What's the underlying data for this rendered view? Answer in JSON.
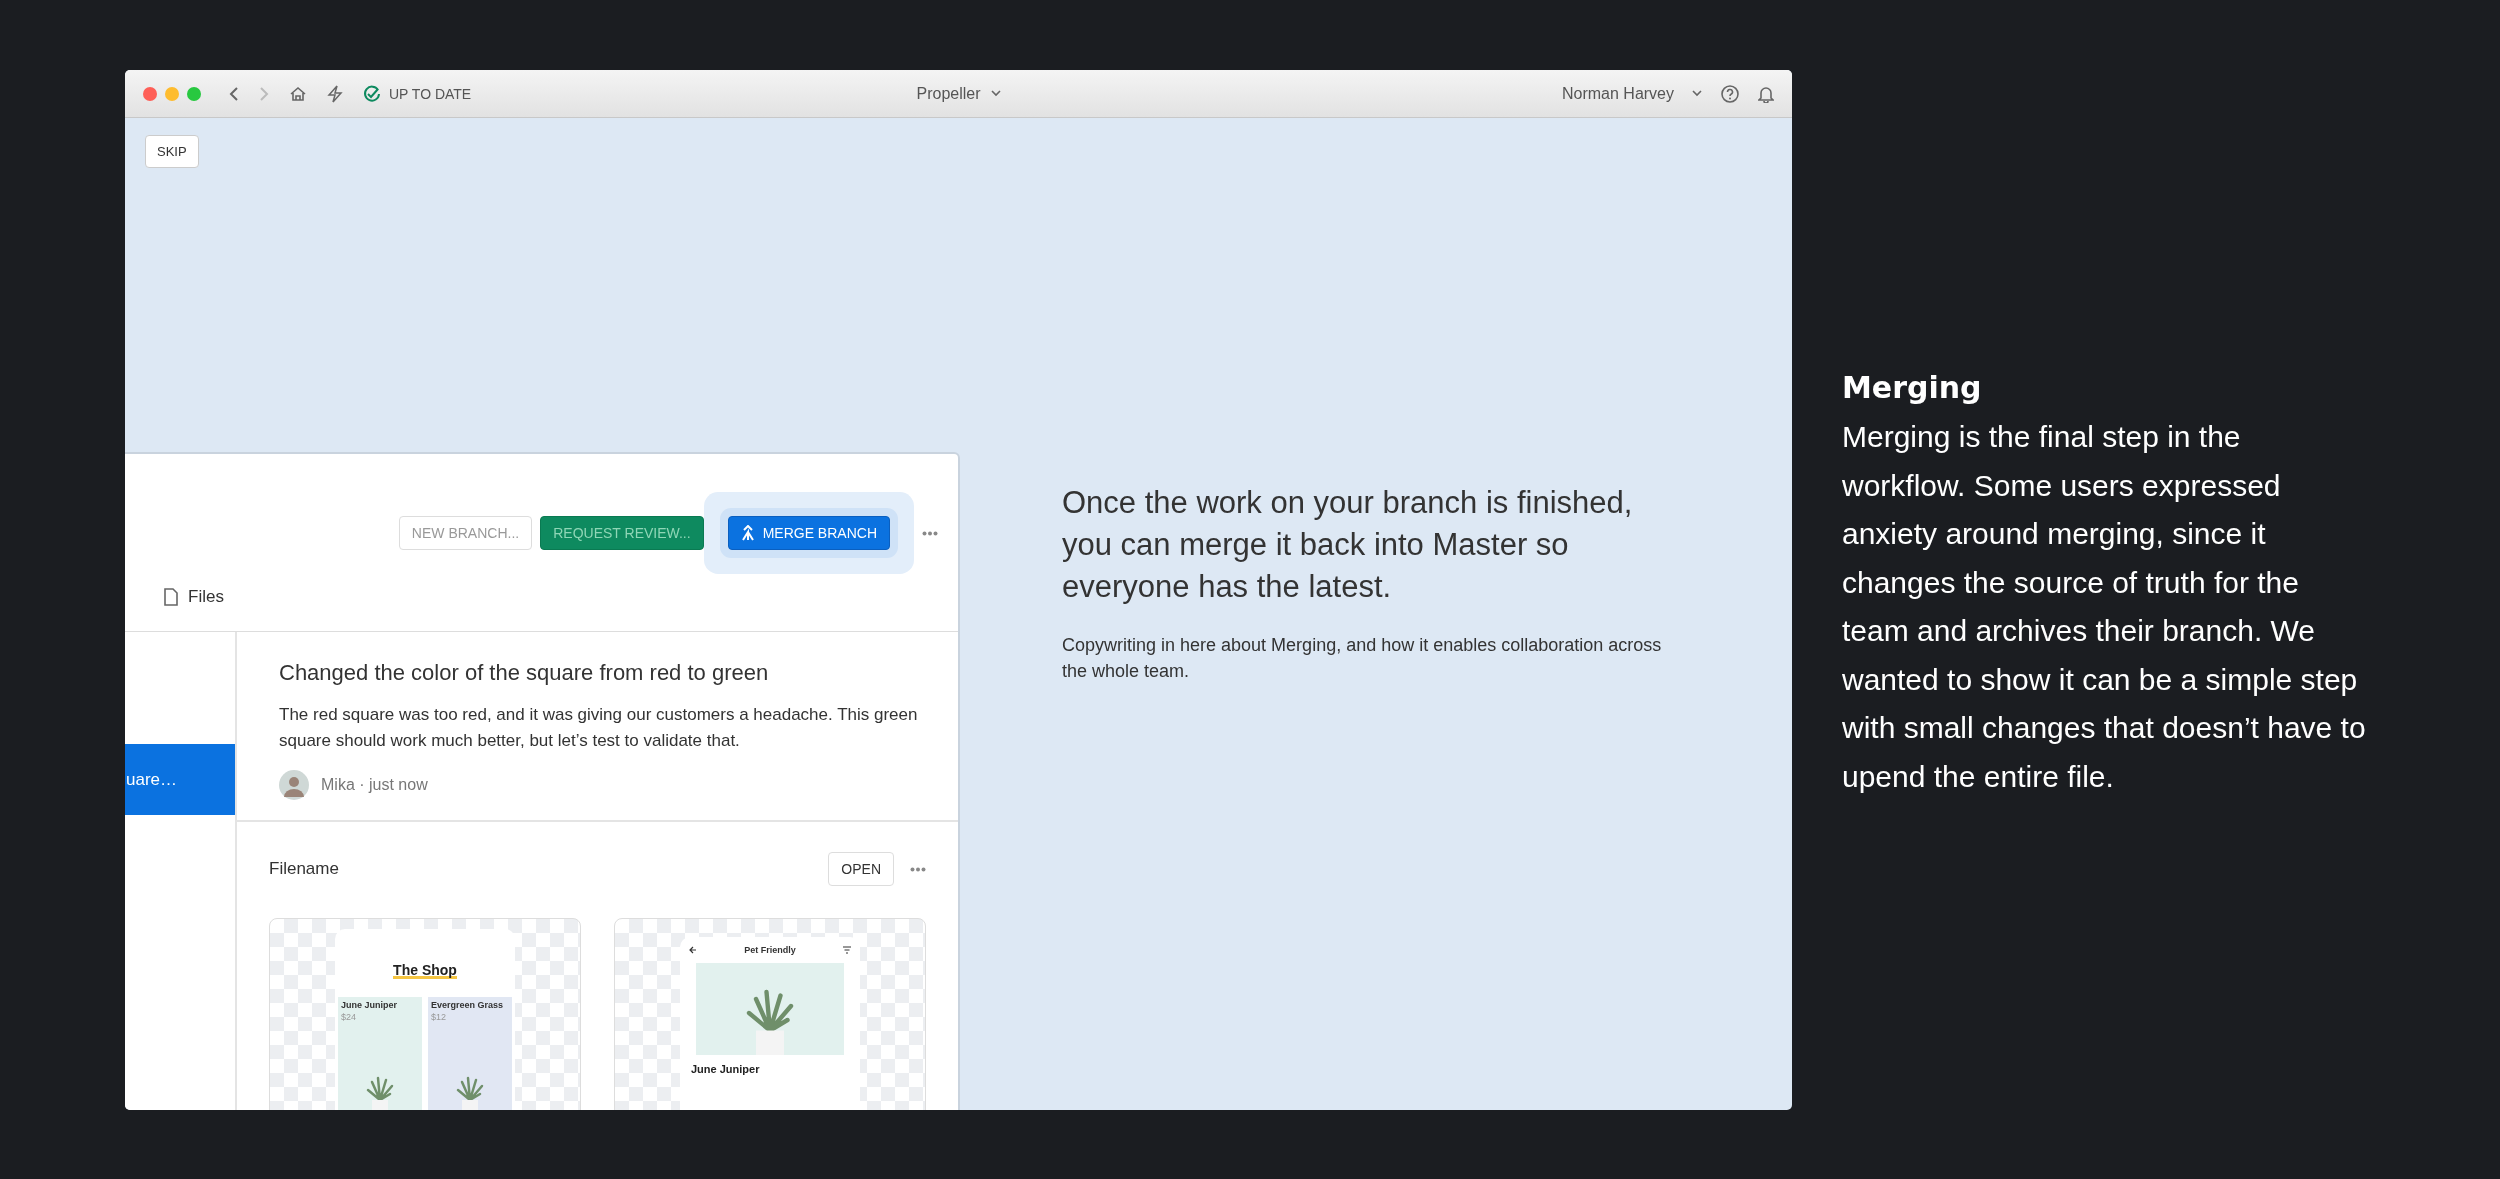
{
  "window": {
    "title": "Propeller",
    "user": "Norman Harvey",
    "sync_status": "UP TO DATE"
  },
  "skip_button": "SKIP",
  "panel": {
    "actions": [
      {
        "label": "NEW BRANCH...",
        "kind": "outline"
      },
      {
        "label": "REQUEST REVIEW...",
        "kind": "green"
      },
      {
        "label": "MERGE BRANCH",
        "kind": "primary"
      }
    ],
    "tab": "Files",
    "sidebar_item": {
      "label": "uare…",
      "selected": true
    },
    "commit": {
      "title": "Changed the color of the square from red to green",
      "body": "The red square was too red, and it was giving our customers a headache. This green square should work much better, but let’s test to validate that.",
      "author": "Mika · just now"
    },
    "file": {
      "name": "Filename",
      "open": "OPEN",
      "thumbnails": [
        {
          "kind": "shop",
          "title": "The Shop",
          "products": [
            {
              "name": "June Juniper",
              "price": "$24"
            },
            {
              "name": "Evergreen Grass",
              "price": "$12"
            }
          ]
        },
        {
          "kind": "detail",
          "title": "Pet Friendly",
          "product": "June Juniper"
        }
      ]
    }
  },
  "callout": {
    "heading": "Once the work on your branch is finished, you can merge it back into Master so everyone has the latest.",
    "body": "Copywriting in here about Merging, and how it enables collaboration across the whole team."
  },
  "note": {
    "title": "Merging",
    "body": "Merging is the final step in the workflow. Some users expressed anxiety around merging, since it changes the source of truth for the team and archives their branch. We wanted to show it can be a simple step with small changes that doesn’t have to upend the entire file."
  }
}
